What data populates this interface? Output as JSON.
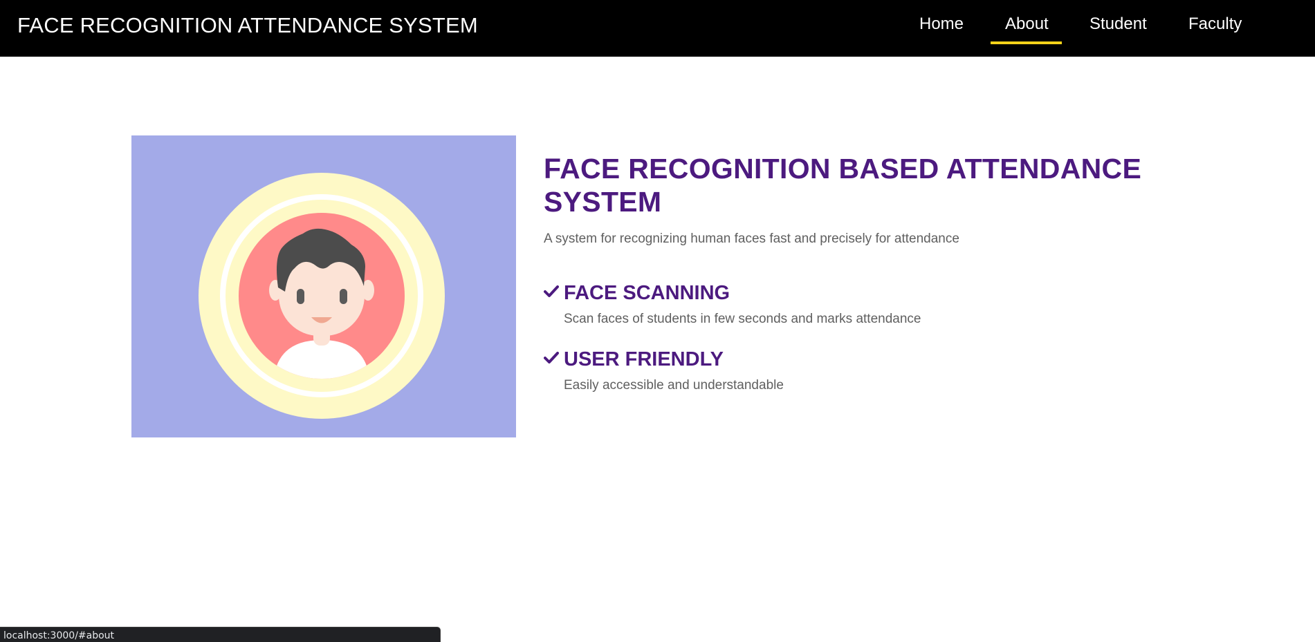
{
  "navbar": {
    "brand": "FACE RECOGNITION ATTENDANCE SYSTEM",
    "links": [
      {
        "label": "Home"
      },
      {
        "label": "About",
        "active": true
      },
      {
        "label": "Student"
      },
      {
        "label": "Faculty"
      }
    ]
  },
  "about": {
    "title": "FACE RECOGNITION BASED ATTENDANCE SYSTEM",
    "subtitle": "A system for recognizing human faces fast and precisely for attendance",
    "features": [
      {
        "title": "FACE SCANNING",
        "description": "Scan faces of students in few seconds and marks attendance",
        "icon": "check-icon"
      },
      {
        "title": "USER FRIENDLY",
        "description": "Easily accessible and understandable",
        "icon": "check-icon"
      }
    ]
  },
  "illustration": {
    "icon": "user-avatar-icon"
  },
  "status_bar": {
    "url": "localhost:3000/#about"
  },
  "colors": {
    "navbar_bg": "#000000",
    "nav_active_underline": "#f5d21a",
    "heading": "#4c1a7f",
    "body_text": "#5f5f5f",
    "hero_bg": "#a3aae8"
  }
}
